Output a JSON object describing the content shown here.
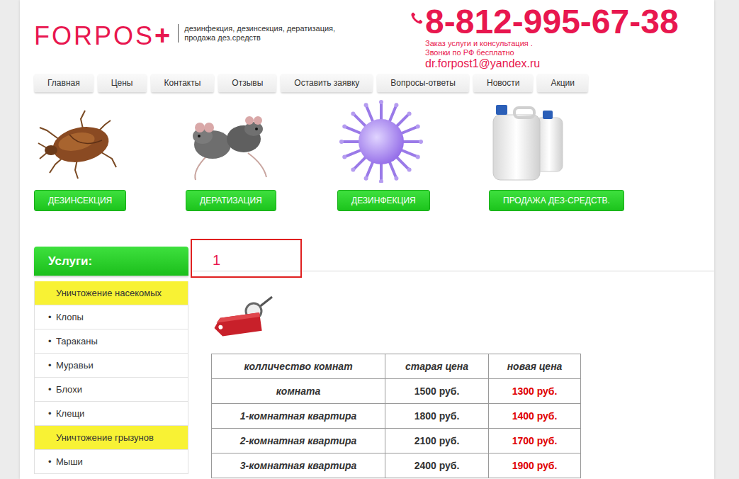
{
  "logo": {
    "name": "FORPOS",
    "mark": "+"
  },
  "tagline": "дезинфекция, дезинсекция, дератизация, продажа дез.средств",
  "contact": {
    "phone": "8-812-995-67-38",
    "note": "Заказ услуги и консультация .",
    "free_calls": "Звонки по РФ бесплатно",
    "email": "dr.forpost1@yandex.ru"
  },
  "nav": [
    {
      "label": "Главная",
      "selected": false
    },
    {
      "label": "Цены",
      "selected": false
    },
    {
      "label": "Контакты",
      "selected": false
    },
    {
      "label": "Отзывы",
      "selected": false
    },
    {
      "label": "Оставить заявку",
      "selected": false
    },
    {
      "label": "Вопросы-ответы",
      "selected": false
    },
    {
      "label": "Новости",
      "selected": false
    },
    {
      "label": "Акции",
      "selected": false
    }
  ],
  "categories": [
    {
      "label": "ДЕЗИНСЕКЦИЯ",
      "kind": "bug"
    },
    {
      "label": "ДЕРАТИЗАЦИЯ",
      "kind": "rodent"
    },
    {
      "label": "ДЕЗИНФЕКЦИЯ",
      "kind": "virus"
    },
    {
      "label": "ПРОДАЖА ДЕЗ-СРЕДСТВ.",
      "kind": "canister"
    }
  ],
  "sidebar": {
    "title": "Услуги:",
    "items": [
      {
        "label": "Уничтожение насекомых",
        "kind": "group"
      },
      {
        "label": "Клопы",
        "kind": "link",
        "marker": "•"
      },
      {
        "label": "Тараканы",
        "kind": "link",
        "marker": "•"
      },
      {
        "label": "Муравьи",
        "kind": "link",
        "marker": "•"
      },
      {
        "label": "Блохи",
        "kind": "link",
        "marker": "•"
      },
      {
        "label": "Клещи",
        "kind": "link",
        "marker": "•"
      },
      {
        "label": "Уничтожение грызунов",
        "kind": "group"
      },
      {
        "label": "Мыши",
        "kind": "link",
        "marker": "•"
      }
    ]
  },
  "content": {
    "heading": "1",
    "highlighted": true,
    "table": {
      "columns": [
        "колличество комнат",
        "старая цена",
        "новая цена"
      ],
      "rows": [
        [
          "комната",
          "1500 руб.",
          "1300 руб."
        ],
        [
          "1-комнатная квартира",
          "1800 руб.",
          "1400 руб."
        ],
        [
          "2-комнатная квартира",
          "2100 руб.",
          "1700 руб."
        ],
        [
          "3-комнатная квартира",
          "2400 руб.",
          "1900 руб."
        ]
      ]
    }
  }
}
